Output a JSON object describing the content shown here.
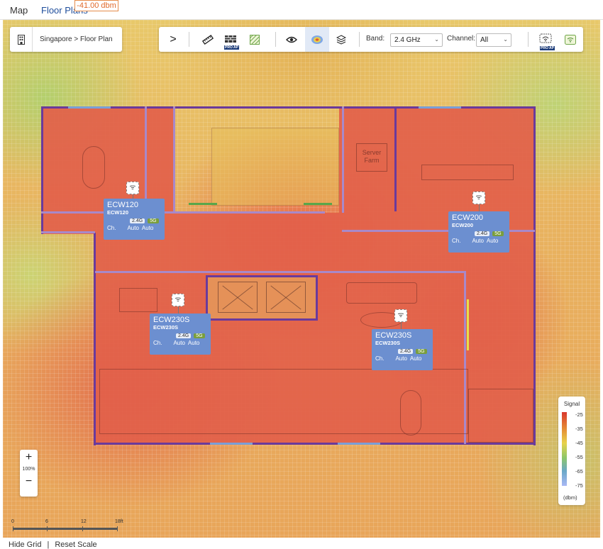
{
  "tabs": {
    "map": "Map",
    "floor_plans": "Floor Plans"
  },
  "location": {
    "breadcrumb": "Singapore > Floor Plan",
    "icon": "building-icon"
  },
  "tooltip": {
    "signal_readout": "-41.00 dbm"
  },
  "toolbar": {
    "expand_icon": ">",
    "band_label": "Band:",
    "band_value": "2.4 GHz",
    "channel_label": "Channel:",
    "channel_value": "All",
    "pro_ap_badge": "PRO AP",
    "icons": [
      "ruler-icon",
      "wall-icon",
      "hatch-icon",
      "eye-icon",
      "heatmap-icon",
      "layers-icon",
      "ap-pro-icon",
      "wifi-icon"
    ]
  },
  "building": {
    "server_room": "Server Farm"
  },
  "aps": [
    {
      "name": "ECW120",
      "model": "ECW120",
      "band1": "2.4G",
      "band2": "5G",
      "ch_label": "Ch.",
      "ch1": "Auto",
      "ch2": "Auto"
    },
    {
      "name": "ECW200",
      "model": "ECW200",
      "band1": "2.4G",
      "band2": "5G",
      "ch_label": "Ch.",
      "ch1": "Auto",
      "ch2": "Auto"
    },
    {
      "name": "ECW230S",
      "model": "ECW230S",
      "band1": "2.4G",
      "band2": "5G",
      "ch_label": "Ch.",
      "ch1": "Auto",
      "ch2": "Auto"
    },
    {
      "name": "ECW230S",
      "model": "ECW230S",
      "band1": "2.4G",
      "band2": "5G",
      "ch_label": "Ch.",
      "ch1": "Auto",
      "ch2": "Auto"
    }
  ],
  "zoom": {
    "in": "+",
    "out": "−",
    "level": "100%"
  },
  "scale": {
    "t0": "0",
    "t1": "6",
    "t2": "12",
    "t3": "18ft"
  },
  "legend": {
    "title": "Signal",
    "ticks": [
      "-25",
      "-35",
      "-45",
      "-55",
      "-65",
      "-75"
    ],
    "unit": "(dbm)",
    "colors": [
      "#d9382e",
      "#e58a34",
      "#e8d24a",
      "#8cc66a",
      "#6aa8c8",
      "#a9b8f5"
    ]
  },
  "footer": {
    "hide_grid": "Hide Grid",
    "separator": "|",
    "reset_scale": "Reset Scale"
  }
}
